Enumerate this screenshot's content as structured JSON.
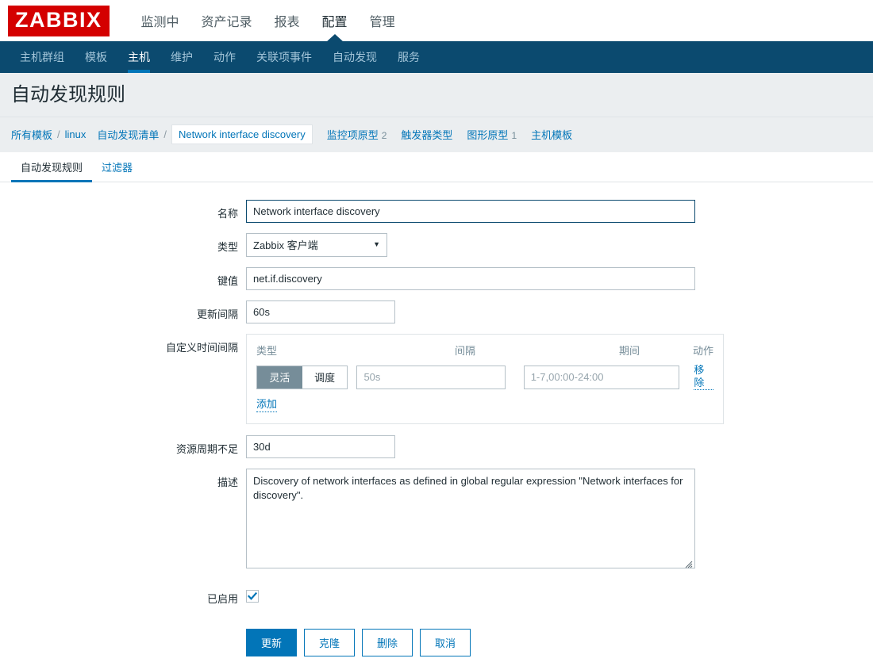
{
  "brand": {
    "logo_text": "ZABBIX",
    "logo_color": "#d40000"
  },
  "theme": {
    "accent": "#0275b8",
    "subnav_bg": "#0b4a6f",
    "page_bg": "#ebeef0",
    "toggle_on_bg": "#768d99"
  },
  "mainnav": {
    "items": [
      {
        "label": "监测中",
        "active": false
      },
      {
        "label": "资产记录",
        "active": false
      },
      {
        "label": "报表",
        "active": false
      },
      {
        "label": "配置",
        "active": true
      },
      {
        "label": "管理",
        "active": false
      }
    ]
  },
  "subnav": {
    "items": [
      {
        "label": "主机群组",
        "active": false
      },
      {
        "label": "模板",
        "active": false
      },
      {
        "label": "主机",
        "active": true
      },
      {
        "label": "维护",
        "active": false
      },
      {
        "label": "动作",
        "active": false
      },
      {
        "label": "关联项事件",
        "active": false
      },
      {
        "label": "自动发现",
        "active": false
      },
      {
        "label": "服务",
        "active": false
      }
    ]
  },
  "page": {
    "title": "自动发现规则"
  },
  "breadcrumb": {
    "all_templates": "所有模板",
    "separator": "/",
    "template": "linux",
    "discovery_list": "自动发现清单",
    "current": "Network interface discovery",
    "tabs": [
      {
        "label": "监控项原型",
        "count": "2"
      },
      {
        "label": "触发器类型",
        "count": ""
      },
      {
        "label": "图形原型",
        "count": "1"
      },
      {
        "label": "主机模板",
        "count": ""
      }
    ]
  },
  "tabs": [
    {
      "label": "自动发现规则",
      "active": true
    },
    {
      "label": "过滤器",
      "active": false
    }
  ],
  "form": {
    "name": {
      "label": "名称",
      "value": "Network interface discovery"
    },
    "type": {
      "label": "类型",
      "value": "Zabbix 客户端"
    },
    "key": {
      "label": "键值",
      "value": "net.if.discovery"
    },
    "update_interval": {
      "label": "更新间隔",
      "value": "60s"
    },
    "custom_intervals": {
      "label": "自定义时间间隔",
      "columns": {
        "type": "类型",
        "interval": "间隔",
        "period": "期间",
        "action": "动作"
      },
      "rows": [
        {
          "flexible_label": "灵活",
          "scheduling_label": "调度",
          "selected": "灵活",
          "interval_placeholder": "50s",
          "interval_value": "",
          "period_placeholder": "1-7,00:00-24:00",
          "period_value": "",
          "remove_label": "移除"
        }
      ],
      "add_label": "添加"
    },
    "lifetime": {
      "label": "资源周期不足",
      "value": "30d"
    },
    "description": {
      "label": "描述",
      "value": "Discovery of network interfaces as defined in global regular expression \"Network interfaces for discovery\"."
    },
    "enabled": {
      "label": "已启用",
      "checked": true
    }
  },
  "buttons": [
    {
      "label": "更新",
      "primary": true
    },
    {
      "label": "克隆",
      "primary": false
    },
    {
      "label": "删除",
      "primary": false
    },
    {
      "label": "取消",
      "primary": false
    }
  ]
}
